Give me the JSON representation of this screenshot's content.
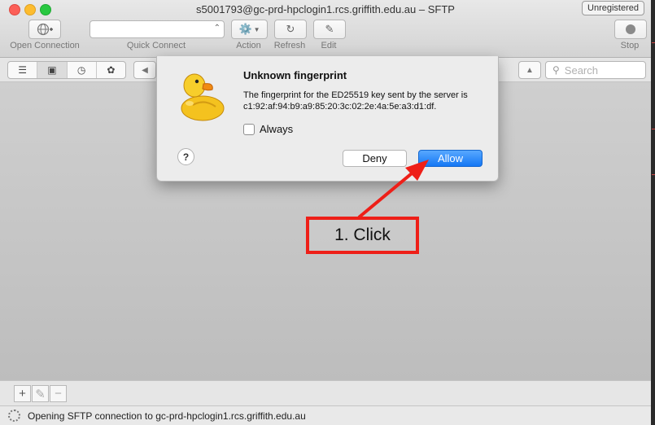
{
  "window": {
    "title": "s5001793@gc-prd-hpclogin1.rcs.griffith.edu.au – SFTP",
    "badge": "Unregistered"
  },
  "toolbar": {
    "open_connection": "Open Connection",
    "quick_connect": "Quick Connect",
    "action": "Action",
    "refresh": "Refresh",
    "edit": "Edit",
    "stop": "Stop"
  },
  "navbar": {
    "search_placeholder": "Search"
  },
  "dialog": {
    "title": "Unknown fingerprint",
    "message": "The fingerprint for the ED25519 key sent by the server is c1:92:af:94:b9:a9:85:20:3c:02:2e:4a:5e:a3:d1:df.",
    "checkbox_label": "Always",
    "help": "?",
    "deny": "Deny",
    "allow": "Allow"
  },
  "annotation": {
    "label": "1. Click",
    "color": "#ee1f18"
  },
  "status": {
    "text": "Opening SFTP connection to gc-prd-hpclogin1.rcs.griffith.edu.au"
  },
  "icons": [
    "globe-plus-icon",
    "gear-icon",
    "refresh-icon",
    "pencil-icon",
    "stop-icon",
    "outline-icon",
    "bookmark-icon",
    "clock-icon",
    "bonjour-icon",
    "search-icon",
    "plus-icon",
    "minus-icon",
    "spinner-icon",
    "duck-logo-icon"
  ]
}
